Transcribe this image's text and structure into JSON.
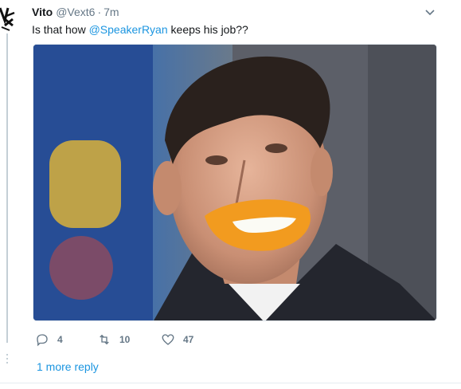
{
  "tweet": {
    "author_name": "Vito",
    "author_handle": "@Vext6",
    "separator": "·",
    "timestamp": "7m",
    "text_before": "Is that how ",
    "mention": "@SpeakerRyan",
    "text_after": " keeps his job??",
    "media": {
      "kind": "photo",
      "subject": "smiling man in suit with orange-painted mouth"
    }
  },
  "actions": {
    "reply_count": "4",
    "retweet_count": "10",
    "like_count": "47"
  },
  "thread": {
    "more_replies_label": "1 more reply"
  },
  "icons": {
    "avatar": "avatar-glyph",
    "caret": "chevron-down-icon",
    "reply": "reply-icon",
    "retweet": "retweet-icon",
    "like": "heart-icon"
  },
  "colors": {
    "accent": "#1b95e0",
    "muted": "#657786",
    "text": "#14171a"
  }
}
